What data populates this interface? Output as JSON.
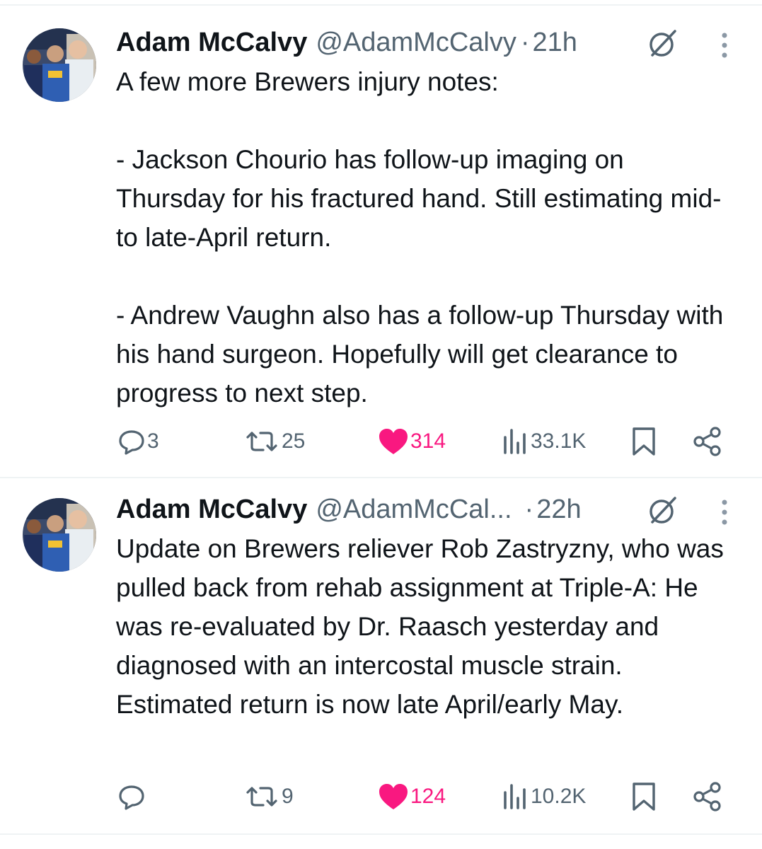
{
  "tweets": [
    {
      "author_name": "Adam McCalvy",
      "handle": "@AdamMcCalvy",
      "time": "21h",
      "separator": "·",
      "text": "A few more Brewers injury notes:\n\n- Jackson Chourio has follow-up imaging on Thursday for his fractured hand. Still estimating mid- to late-April return.\n\n- Andrew Vaughn also has a follow-up Thursday with his hand surgeon. Hopefully will get clearance to progress to next step.",
      "replies": "3",
      "reposts": "25",
      "likes": "314",
      "views": "33.1K",
      "liked": true
    },
    {
      "author_name": "Adam McCalvy",
      "handle": "@AdamMcCal...",
      "time": "22h",
      "separator": "·",
      "text": "Update on Brewers reliever Rob Zastryzny, who was pulled back from rehab assignment at Triple-A: He was re-evaluated by Dr. Raasch yesterday and diagnosed with an intercostal muscle strain. Estimated return is now late April/early May.",
      "replies": "",
      "reposts": "9",
      "likes": "124",
      "views": "10.2K",
      "liked": true
    }
  ],
  "colors": {
    "text": "#0f1419",
    "secondary": "#536471",
    "like": "#f91880",
    "divider": "#eff3f4"
  },
  "icons": [
    "reply-icon",
    "repost-icon",
    "heart-icon",
    "views-icon",
    "bookmark-icon",
    "share-icon",
    "grok-icon",
    "more-icon"
  ]
}
